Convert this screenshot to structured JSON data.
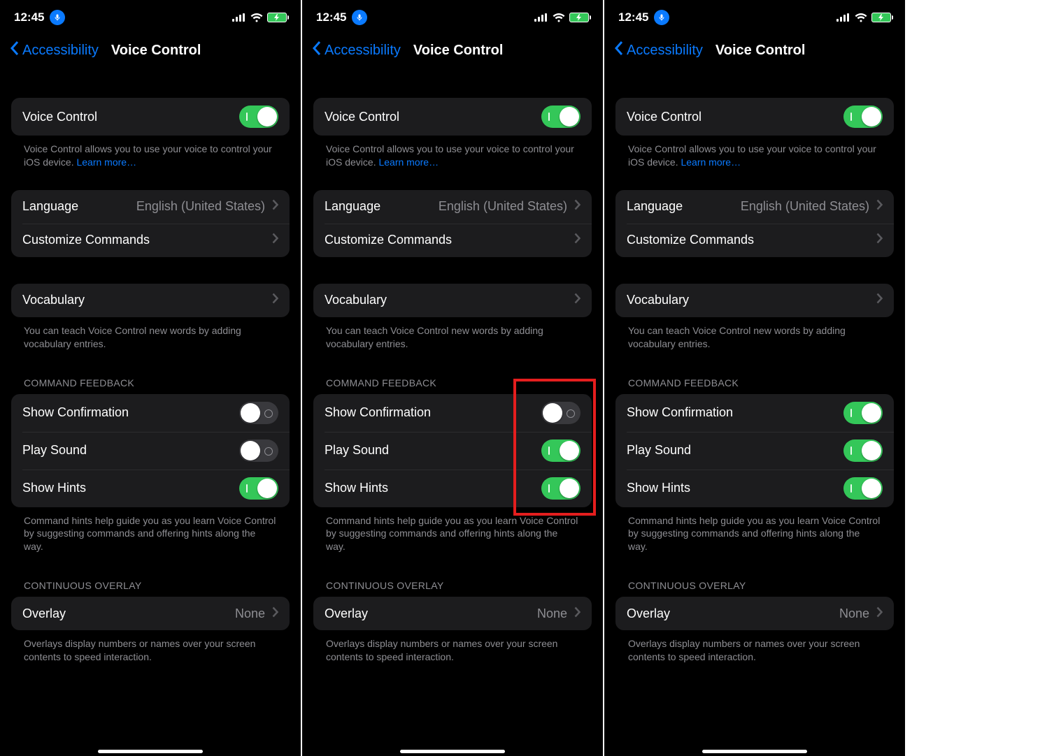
{
  "status": {
    "time": "12:45"
  },
  "nav": {
    "back_label": "Accessibility",
    "title": "Voice Control"
  },
  "voice_control": {
    "label": "Voice Control",
    "footer_prefix": "Voice Control allows you to use your voice to control your iOS device. ",
    "learn_more": "Learn more…"
  },
  "language": {
    "label": "Language",
    "value": "English (United States)"
  },
  "customize": {
    "label": "Customize Commands"
  },
  "vocabulary": {
    "label": "Vocabulary",
    "footer": "You can teach Voice Control new words by adding vocabulary entries."
  },
  "command_feedback": {
    "header": "COMMAND FEEDBACK",
    "show_confirmation": "Show Confirmation",
    "play_sound": "Play Sound",
    "show_hints": "Show Hints",
    "footer": "Command hints help guide you as you learn Voice Control by suggesting commands and offering hints along the way."
  },
  "continuous_overlay": {
    "header": "CONTINUOUS OVERLAY",
    "overlay": "Overlay",
    "overlay_value": "None",
    "footer": "Overlays display numbers or names over your screen contents to speed interaction."
  },
  "screens": [
    {
      "show_confirmation_on": false,
      "play_sound_on": false,
      "show_hints_on": true,
      "highlight": false
    },
    {
      "show_confirmation_on": false,
      "play_sound_on": true,
      "show_hints_on": true,
      "highlight": true
    },
    {
      "show_confirmation_on": true,
      "play_sound_on": true,
      "show_hints_on": true,
      "highlight": false
    }
  ]
}
